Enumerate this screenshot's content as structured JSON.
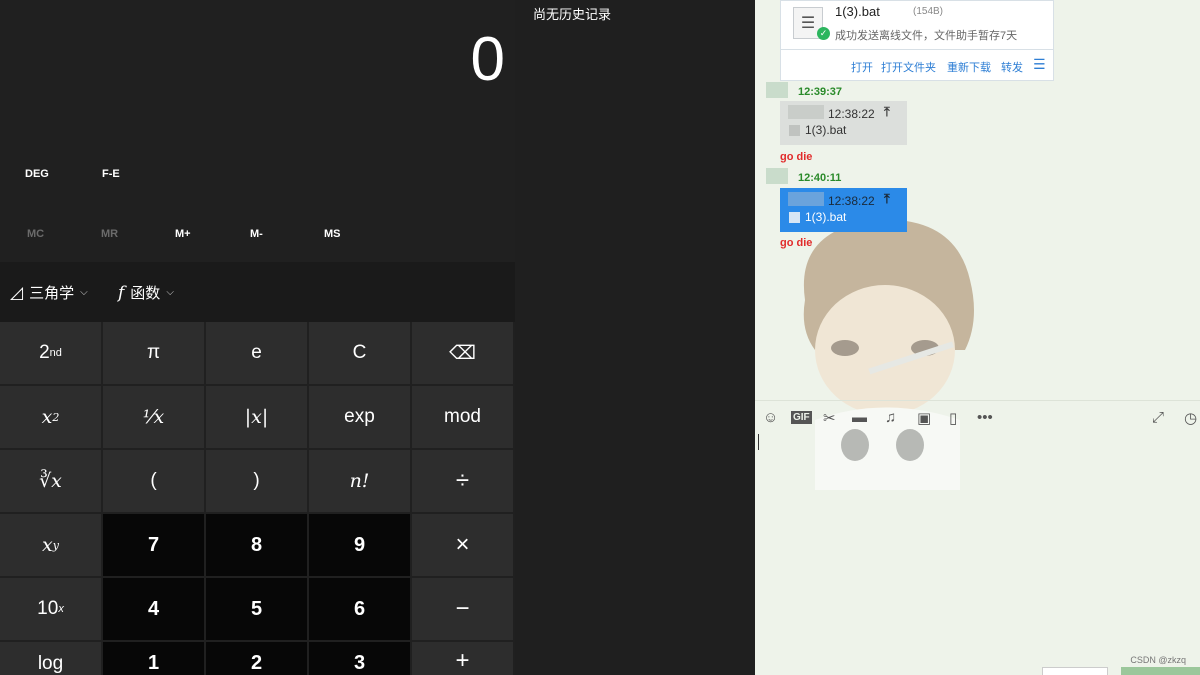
{
  "calculator": {
    "display_value": "0",
    "modes": [
      "DEG",
      "F-E"
    ],
    "memory": [
      {
        "label": "MC",
        "enabled": false
      },
      {
        "label": "MR",
        "enabled": false
      },
      {
        "label": "M+",
        "enabled": true
      },
      {
        "label": "M-",
        "enabled": true
      },
      {
        "label": "MS",
        "enabled": true
      }
    ],
    "trig_label": "三角学",
    "func_label": "函数",
    "keys": {
      "second": "2",
      "second_sup": "nd",
      "pi": "π",
      "e": "e",
      "clear": "C",
      "backspace": "⌫",
      "square": "x",
      "square_sup": "2",
      "reciprocal": "⅟x",
      "abs": "|x|",
      "exp": "exp",
      "mod": "mod",
      "root": "∛x",
      "lparen": "(",
      "rparen": ")",
      "factorial": "n!",
      "divide": "÷",
      "power": "x",
      "power_sup": "y",
      "n7": "7",
      "n8": "8",
      "n9": "9",
      "multiply": "×",
      "tenpow": "10",
      "tenpow_sup": "x",
      "n4": "4",
      "n5": "5",
      "n6": "6",
      "minus": "−",
      "log": "log",
      "n1": "1",
      "n2": "2",
      "n3": "3",
      "plus": "+"
    }
  },
  "history": {
    "empty_text": "尚无历史记录"
  },
  "chat": {
    "file_card": {
      "name": "1(3).bat",
      "size": "(154B)",
      "status": "成功发送离线文件，文件助手暂存7天",
      "actions": [
        "打开",
        "打开文件夹",
        "重新下载",
        "转发"
      ]
    },
    "messages": [
      {
        "time": "12:39:37",
        "file_time": "12:38:22",
        "file_name": "1(3).bat",
        "reply": "go die"
      },
      {
        "time": "12:40:11",
        "file_time": "12:38:22",
        "file_name": "1(3).bat",
        "reply": "go die"
      }
    ],
    "watermark": "CSDN @zkzq"
  }
}
